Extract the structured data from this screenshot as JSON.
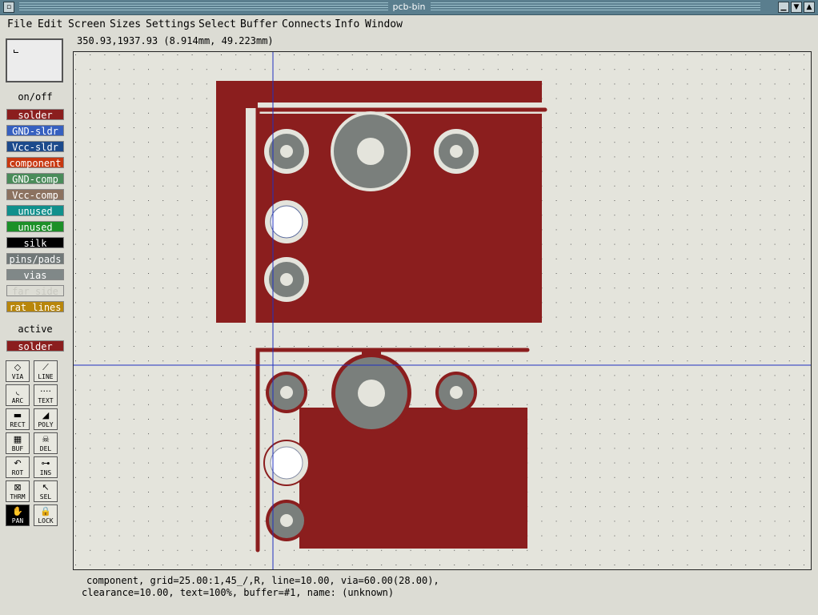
{
  "window": {
    "title": "pcb-bin"
  },
  "menu": [
    "File",
    "Edit",
    "Screen",
    "Sizes",
    "Settings",
    "Select",
    "Buffer",
    "Connects",
    "Info",
    "Window"
  ],
  "cursor_readout": "350.93,1937.93 (8.914mm, 49.223mm)",
  "layers": {
    "onoff_label": "on/off",
    "items": [
      {
        "label": "solder",
        "bg": "#8b1e1e",
        "fg": "#ffffff"
      },
      {
        "label": "GND-sldr",
        "bg": "#3660c0",
        "fg": "#ffffff"
      },
      {
        "label": "Vcc-sldr",
        "bg": "#1c4a8c",
        "fg": "#ffffff"
      },
      {
        "label": "component",
        "bg": "#c83810",
        "fg": "#ffffff"
      },
      {
        "label": "GND-comp",
        "bg": "#4a8c5a",
        "fg": "#ffffff"
      },
      {
        "label": "Vcc-comp",
        "bg": "#8c7260",
        "fg": "#ffffff"
      },
      {
        "label": "unused",
        "bg": "#10908c",
        "fg": "#ffffff"
      },
      {
        "label": "unused",
        "bg": "#1c9028",
        "fg": "#ffffff"
      },
      {
        "label": "silk",
        "bg": "#000000",
        "fg": "#ffffff"
      },
      {
        "label": "pins/pads",
        "bg": "#707878",
        "fg": "#ffffff"
      },
      {
        "label": "vias",
        "bg": "#808888",
        "fg": "#ffffff"
      },
      {
        "label": "far side",
        "bg": "#dcdcd4",
        "fg": "#c8c8c0"
      },
      {
        "label": "rat lines",
        "bg": "#b8860b",
        "fg": "#ffffff"
      }
    ],
    "active_label": "active",
    "active_layer": {
      "label": "solder",
      "bg": "#8b1e1e",
      "fg": "#ffffff"
    }
  },
  "tools": [
    {
      "icon": "◇",
      "label": "VIA",
      "name": "via-tool"
    },
    {
      "icon": "⟋",
      "label": "LINE",
      "name": "line-tool"
    },
    {
      "icon": "◟",
      "label": "ARC",
      "name": "arc-tool"
    },
    {
      "icon": "····",
      "label": "TEXT",
      "name": "text-tool"
    },
    {
      "icon": "▬",
      "label": "RECT",
      "name": "rect-tool"
    },
    {
      "icon": "◢",
      "label": "POLY",
      "name": "poly-tool"
    },
    {
      "icon": "▦",
      "label": "BUF",
      "name": "buffer-tool"
    },
    {
      "icon": "☠",
      "label": "DEL",
      "name": "delete-tool"
    },
    {
      "icon": "↶",
      "label": "ROT",
      "name": "rotate-tool"
    },
    {
      "icon": "⊶",
      "label": "INS",
      "name": "insert-tool"
    },
    {
      "icon": "⊠",
      "label": "THRM",
      "name": "thermal-tool"
    },
    {
      "icon": "↖",
      "label": "SEL",
      "name": "select-tool"
    },
    {
      "icon": "✋",
      "label": "PAN",
      "name": "pan-tool",
      "active": true
    },
    {
      "icon": "🔒",
      "label": "LOCK",
      "name": "lock-tool"
    }
  ],
  "status": {
    "line1": "component, grid=25.00:1,45_/,R, line=10.00, via=60.00(28.00),",
    "line2": "clearance=10.00, text=100%, buffer=#1, name: (unknown)"
  },
  "colors": {
    "copper": "#8b1e1e",
    "pad": "#7a7f7c",
    "board_bg": "#e4e4dc",
    "crosshair": "#2030c0"
  }
}
